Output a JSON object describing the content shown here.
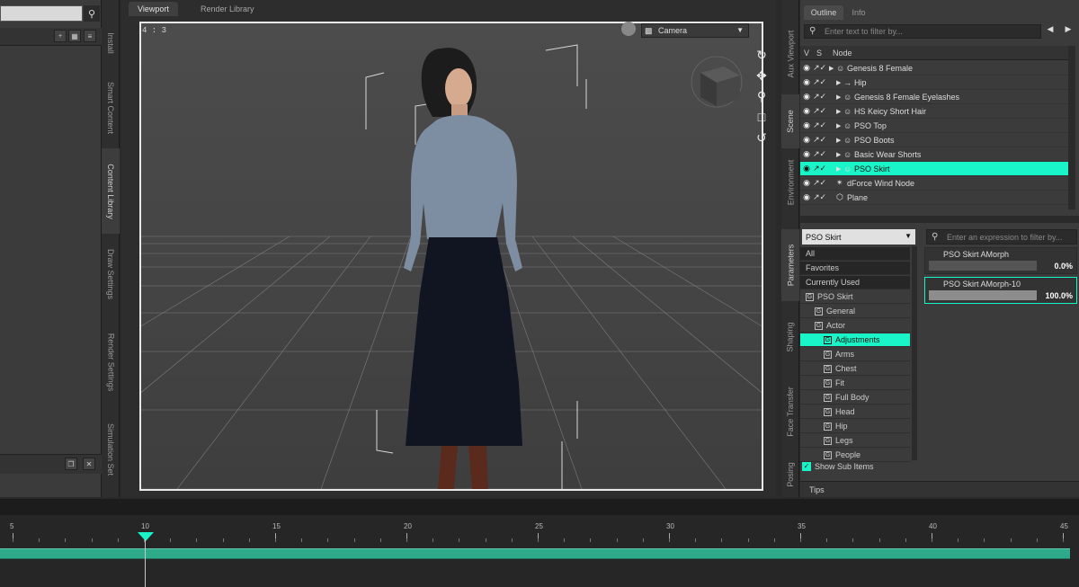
{
  "viewport": {
    "tabs": [
      "Viewport",
      "Render Library"
    ],
    "aspect": "4 : 3",
    "camera": "Camera"
  },
  "left_tabs": [
    "Install",
    "Smart Content",
    "Content Library",
    "Draw Settings",
    "Render Settings",
    "Simulation Set"
  ],
  "right_tabs": [
    "Aux Viewport",
    "Scene",
    "Environment",
    "Parameters",
    "Shaping",
    "Face Transfer",
    "Posing"
  ],
  "scene": {
    "tabs": [
      "Outline",
      "Info"
    ],
    "filter_placeholder": "Enter text to filter by...",
    "columns": [
      "V",
      "S",
      "Node"
    ],
    "nodes": [
      {
        "label": "Genesis 8 Female",
        "selected": false
      },
      {
        "label": "Hip",
        "selected": false
      },
      {
        "label": "Genesis 8 Female Eyelashes",
        "selected": false
      },
      {
        "label": "HS Keicy Short Hair",
        "selected": false
      },
      {
        "label": "PSO Top",
        "selected": false
      },
      {
        "label": "PSO Boots",
        "selected": false
      },
      {
        "label": "Basic Wear Shorts",
        "selected": false
      },
      {
        "label": "PSO Skirt",
        "selected": true
      },
      {
        "label": "dForce Wind Node",
        "selected": false
      },
      {
        "label": "Plane",
        "selected": false
      }
    ]
  },
  "parameters": {
    "node_select": "PSO Skirt",
    "filter_placeholder": "Enter an expression to filter by...",
    "tree": [
      {
        "label": "All"
      },
      {
        "label": "Favorites"
      },
      {
        "label": "Currently Used"
      },
      {
        "label": "PSO Skirt"
      },
      {
        "label": "General"
      },
      {
        "label": "Actor"
      },
      {
        "label": "Adjustments"
      },
      {
        "label": "Arms"
      },
      {
        "label": "Chest"
      },
      {
        "label": "Fit"
      },
      {
        "label": "Full Body"
      },
      {
        "label": "Head"
      },
      {
        "label": "Hip"
      },
      {
        "label": "Legs"
      },
      {
        "label": "People"
      }
    ],
    "show_sub_items": "Show Sub Items",
    "sliders": [
      {
        "name": "PSO Skirt AMorph",
        "value": "0.0%",
        "level": 0.0
      },
      {
        "name": "PSO Skirt AMorph-10",
        "value": "100.0%",
        "level": 1.0
      }
    ],
    "tips": "Tips"
  },
  "timeline": {
    "ticks": [
      "5",
      "10",
      "15",
      "20",
      "25",
      "30",
      "35",
      "40",
      "45"
    ],
    "current_frame": 10
  }
}
